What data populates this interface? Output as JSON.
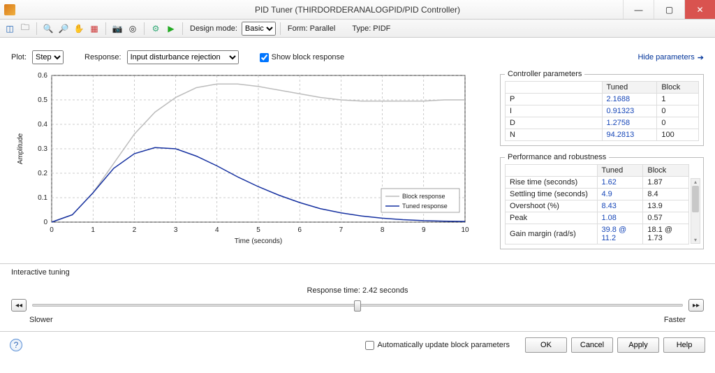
{
  "window": {
    "title": "PID Tuner (THIRDORDERANALOGPID/PID Controller)"
  },
  "toolbar": {
    "design_mode_label": "Design mode:",
    "design_mode_value": "Basic",
    "form_label": "Form: Parallel",
    "type_label": "Type: PIDF"
  },
  "controls": {
    "plot_label": "Plot:",
    "plot_value": "Step",
    "response_label": "Response:",
    "response_value": "Input disturbance rejection",
    "show_block_response": "Show block response",
    "hide_parameters": "Hide parameters"
  },
  "chart_data": {
    "type": "line",
    "xlabel": "Time (seconds)",
    "ylabel": "Amplitude",
    "xlim": [
      0,
      10
    ],
    "ylim": [
      0,
      0.6
    ],
    "xticks": [
      0,
      1,
      2,
      3,
      4,
      5,
      6,
      7,
      8,
      9,
      10
    ],
    "yticks": [
      0,
      0.1,
      0.2,
      0.3,
      0.4,
      0.5,
      0.6
    ],
    "legend": [
      "Block response",
      "Tuned response"
    ],
    "series": [
      {
        "name": "Block response",
        "color": "#bcbcbc",
        "x": [
          0,
          0.5,
          1,
          1.5,
          2,
          2.5,
          3,
          3.5,
          4,
          4.5,
          5,
          5.5,
          6,
          6.5,
          7,
          7.5,
          8,
          8.5,
          9,
          9.5,
          10
        ],
        "values": [
          0.0,
          0.03,
          0.12,
          0.24,
          0.36,
          0.45,
          0.51,
          0.55,
          0.565,
          0.565,
          0.555,
          0.54,
          0.525,
          0.51,
          0.5,
          0.495,
          0.495,
          0.495,
          0.495,
          0.5,
          0.5
        ]
      },
      {
        "name": "Tuned response",
        "color": "#1530a0",
        "x": [
          0,
          0.5,
          1,
          1.5,
          2,
          2.5,
          3,
          3.5,
          4,
          4.5,
          5,
          5.5,
          6,
          6.5,
          7,
          7.5,
          8,
          8.5,
          9,
          9.5,
          10
        ],
        "values": [
          0.0,
          0.03,
          0.12,
          0.22,
          0.28,
          0.305,
          0.3,
          0.27,
          0.23,
          0.185,
          0.145,
          0.11,
          0.08,
          0.055,
          0.038,
          0.025,
          0.016,
          0.01,
          0.006,
          0.004,
          0.003
        ]
      }
    ]
  },
  "controller_params": {
    "title": "Controller parameters",
    "headers": [
      "",
      "Tuned",
      "Block"
    ],
    "rows": [
      {
        "name": "P",
        "tuned": "2.1688",
        "block": "1"
      },
      {
        "name": "I",
        "tuned": "0.91323",
        "block": "0"
      },
      {
        "name": "D",
        "tuned": "1.2758",
        "block": "0"
      },
      {
        "name": "N",
        "tuned": "94.2813",
        "block": "100"
      }
    ]
  },
  "performance": {
    "title": "Performance and robustness",
    "headers": [
      "",
      "Tuned",
      "Block"
    ],
    "rows": [
      {
        "name": "Rise time (seconds)",
        "tuned": "1.62",
        "block": "1.87"
      },
      {
        "name": "Settling time (seconds)",
        "tuned": "4.9",
        "block": "8.4"
      },
      {
        "name": "Overshoot (%)",
        "tuned": "8.43",
        "block": "13.9"
      },
      {
        "name": "Peak",
        "tuned": "1.08",
        "block": "0.57"
      },
      {
        "name": "Gain margin (rad/s)",
        "tuned": "39.8 @ 11.2",
        "block": "18.1 @ 1.73"
      }
    ]
  },
  "interactive": {
    "title": "Interactive tuning",
    "response_time": "Response time: 2.42 seconds",
    "slower": "Slower",
    "faster": "Faster"
  },
  "footer": {
    "auto_update": "Automatically update block parameters",
    "ok": "OK",
    "cancel": "Cancel",
    "apply": "Apply",
    "help": "Help"
  }
}
